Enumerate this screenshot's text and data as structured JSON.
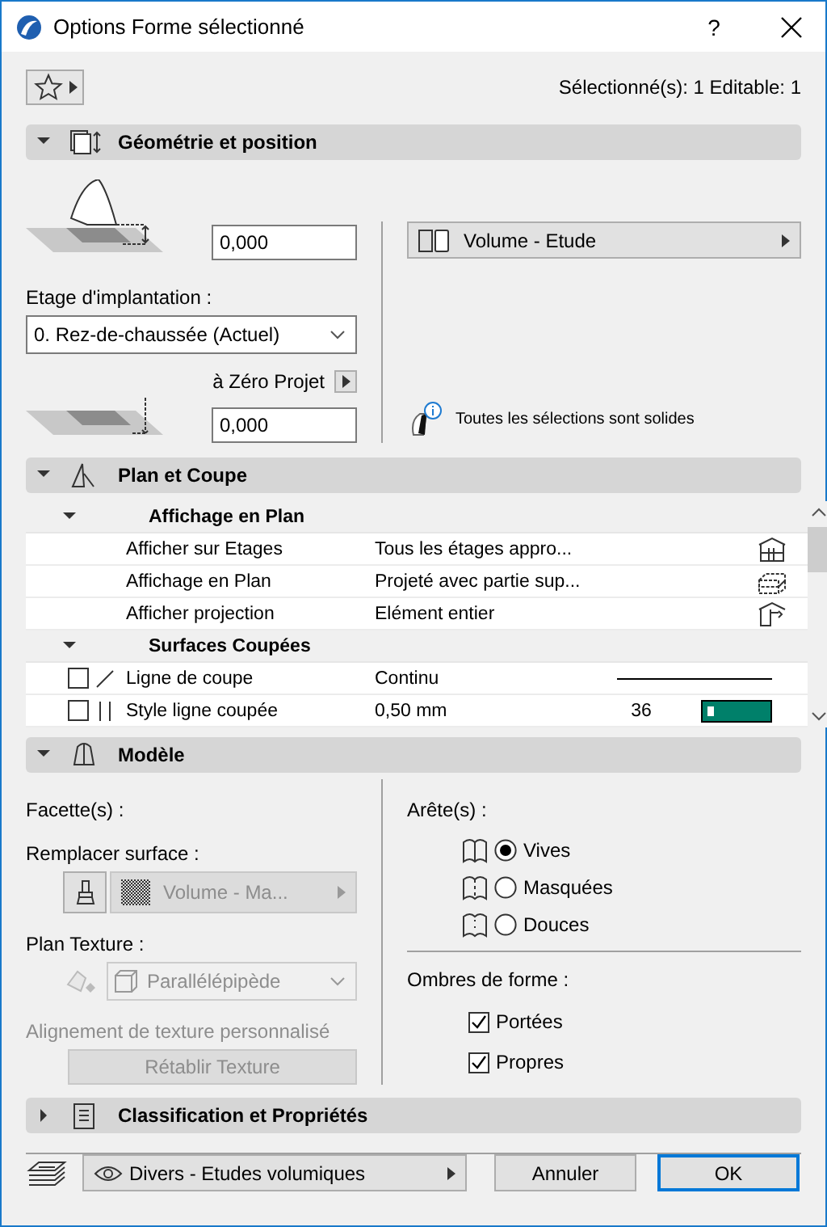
{
  "window": {
    "title": "Options Forme sélectionné",
    "help": "?"
  },
  "toolbar": {
    "selection_info": "Sélectionné(s): 1 Editable: 1"
  },
  "geometry": {
    "title": "Géométrie et position",
    "expanded": true,
    "height_value": "0,000",
    "story_label": "Etage d'implantation :",
    "story_value": "0. Rez-de-chaussée (Actuel)",
    "ref_label": "à Zéro Projet",
    "offset_value": "0,000",
    "material": "Volume - Etude",
    "info": "Toutes les sélections sont solides"
  },
  "plan_section": {
    "title": "Plan et Coupe",
    "expanded": true,
    "groups": [
      {
        "title": "Affichage en Plan",
        "expanded": true,
        "rows": [
          {
            "kind": "stories",
            "name": "Afficher sur Etages",
            "value": "Tous les étages appro..."
          },
          {
            "kind": "floorplan",
            "name": "Affichage en Plan",
            "value": "Projeté avec partie sup..."
          },
          {
            "kind": "projection",
            "name": "Afficher projection",
            "value": "Elément entier"
          }
        ]
      },
      {
        "title": "Surfaces Coupées",
        "expanded": true,
        "rows": [
          {
            "kind": "line",
            "name": "Ligne de coupe",
            "value": "Continu",
            "checked": false
          },
          {
            "kind": "pen",
            "name": "Style ligne coupée",
            "value": "0,50 mm",
            "pen": "36",
            "color": "#00806a",
            "checked": false
          }
        ]
      }
    ]
  },
  "model": {
    "title": "Modèle",
    "expanded": true,
    "facets_label": "Facette(s) :",
    "override_label": "Remplacer surface :",
    "override_value": "Volume - Ma...",
    "override_disabled": true,
    "texture_label": "Plan Texture :",
    "texture_value": "Parallélépipède",
    "texture_disabled": true,
    "align_label": "Alignement de texture personnalisé",
    "reset_button": "Rétablir Texture",
    "reset_disabled": true,
    "edges_label": "Arête(s) :",
    "edges": [
      {
        "kind": "sharp",
        "label": "Vives",
        "selected": true
      },
      {
        "kind": "hidden",
        "label": "Masquées",
        "selected": false
      },
      {
        "kind": "smooth",
        "label": "Douces",
        "selected": false
      }
    ],
    "shadows_label": "Ombres de forme :",
    "shadows": [
      {
        "label": "Portées",
        "checked": true
      },
      {
        "label": "Propres",
        "checked": true
      }
    ]
  },
  "classification": {
    "title": "Classification et Propriétés",
    "expanded": false
  },
  "footer": {
    "layer": "Divers - Etudes volumiques",
    "cancel": "Annuler",
    "ok": "OK"
  }
}
